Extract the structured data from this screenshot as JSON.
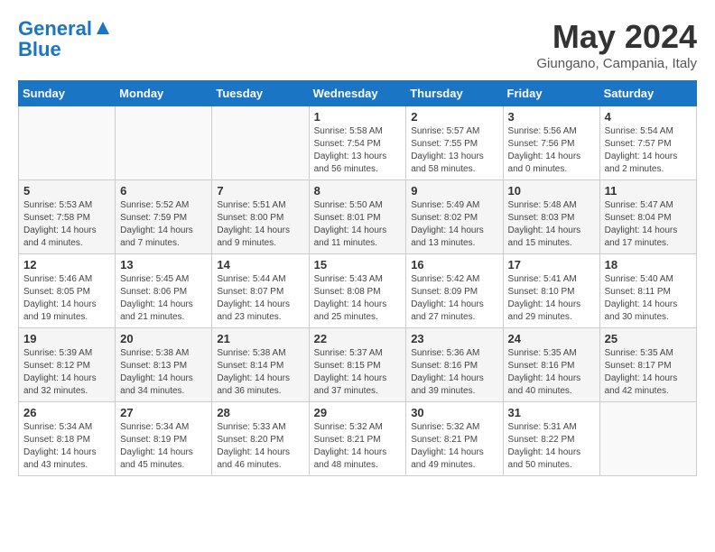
{
  "header": {
    "logo_line1": "General",
    "logo_line2": "Blue",
    "month_title": "May 2024",
    "location": "Giungano, Campania, Italy"
  },
  "days_of_week": [
    "Sunday",
    "Monday",
    "Tuesday",
    "Wednesday",
    "Thursday",
    "Friday",
    "Saturday"
  ],
  "weeks": [
    [
      {
        "day": "",
        "info": ""
      },
      {
        "day": "",
        "info": ""
      },
      {
        "day": "",
        "info": ""
      },
      {
        "day": "1",
        "info": "Sunrise: 5:58 AM\nSunset: 7:54 PM\nDaylight: 13 hours\nand 56 minutes."
      },
      {
        "day": "2",
        "info": "Sunrise: 5:57 AM\nSunset: 7:55 PM\nDaylight: 13 hours\nand 58 minutes."
      },
      {
        "day": "3",
        "info": "Sunrise: 5:56 AM\nSunset: 7:56 PM\nDaylight: 14 hours\nand 0 minutes."
      },
      {
        "day": "4",
        "info": "Sunrise: 5:54 AM\nSunset: 7:57 PM\nDaylight: 14 hours\nand 2 minutes."
      }
    ],
    [
      {
        "day": "5",
        "info": "Sunrise: 5:53 AM\nSunset: 7:58 PM\nDaylight: 14 hours\nand 4 minutes."
      },
      {
        "day": "6",
        "info": "Sunrise: 5:52 AM\nSunset: 7:59 PM\nDaylight: 14 hours\nand 7 minutes."
      },
      {
        "day": "7",
        "info": "Sunrise: 5:51 AM\nSunset: 8:00 PM\nDaylight: 14 hours\nand 9 minutes."
      },
      {
        "day": "8",
        "info": "Sunrise: 5:50 AM\nSunset: 8:01 PM\nDaylight: 14 hours\nand 11 minutes."
      },
      {
        "day": "9",
        "info": "Sunrise: 5:49 AM\nSunset: 8:02 PM\nDaylight: 14 hours\nand 13 minutes."
      },
      {
        "day": "10",
        "info": "Sunrise: 5:48 AM\nSunset: 8:03 PM\nDaylight: 14 hours\nand 15 minutes."
      },
      {
        "day": "11",
        "info": "Sunrise: 5:47 AM\nSunset: 8:04 PM\nDaylight: 14 hours\nand 17 minutes."
      }
    ],
    [
      {
        "day": "12",
        "info": "Sunrise: 5:46 AM\nSunset: 8:05 PM\nDaylight: 14 hours\nand 19 minutes."
      },
      {
        "day": "13",
        "info": "Sunrise: 5:45 AM\nSunset: 8:06 PM\nDaylight: 14 hours\nand 21 minutes."
      },
      {
        "day": "14",
        "info": "Sunrise: 5:44 AM\nSunset: 8:07 PM\nDaylight: 14 hours\nand 23 minutes."
      },
      {
        "day": "15",
        "info": "Sunrise: 5:43 AM\nSunset: 8:08 PM\nDaylight: 14 hours\nand 25 minutes."
      },
      {
        "day": "16",
        "info": "Sunrise: 5:42 AM\nSunset: 8:09 PM\nDaylight: 14 hours\nand 27 minutes."
      },
      {
        "day": "17",
        "info": "Sunrise: 5:41 AM\nSunset: 8:10 PM\nDaylight: 14 hours\nand 29 minutes."
      },
      {
        "day": "18",
        "info": "Sunrise: 5:40 AM\nSunset: 8:11 PM\nDaylight: 14 hours\nand 30 minutes."
      }
    ],
    [
      {
        "day": "19",
        "info": "Sunrise: 5:39 AM\nSunset: 8:12 PM\nDaylight: 14 hours\nand 32 minutes."
      },
      {
        "day": "20",
        "info": "Sunrise: 5:38 AM\nSunset: 8:13 PM\nDaylight: 14 hours\nand 34 minutes."
      },
      {
        "day": "21",
        "info": "Sunrise: 5:38 AM\nSunset: 8:14 PM\nDaylight: 14 hours\nand 36 minutes."
      },
      {
        "day": "22",
        "info": "Sunrise: 5:37 AM\nSunset: 8:15 PM\nDaylight: 14 hours\nand 37 minutes."
      },
      {
        "day": "23",
        "info": "Sunrise: 5:36 AM\nSunset: 8:16 PM\nDaylight: 14 hours\nand 39 minutes."
      },
      {
        "day": "24",
        "info": "Sunrise: 5:35 AM\nSunset: 8:16 PM\nDaylight: 14 hours\nand 40 minutes."
      },
      {
        "day": "25",
        "info": "Sunrise: 5:35 AM\nSunset: 8:17 PM\nDaylight: 14 hours\nand 42 minutes."
      }
    ],
    [
      {
        "day": "26",
        "info": "Sunrise: 5:34 AM\nSunset: 8:18 PM\nDaylight: 14 hours\nand 43 minutes."
      },
      {
        "day": "27",
        "info": "Sunrise: 5:34 AM\nSunset: 8:19 PM\nDaylight: 14 hours\nand 45 minutes."
      },
      {
        "day": "28",
        "info": "Sunrise: 5:33 AM\nSunset: 8:20 PM\nDaylight: 14 hours\nand 46 minutes."
      },
      {
        "day": "29",
        "info": "Sunrise: 5:32 AM\nSunset: 8:21 PM\nDaylight: 14 hours\nand 48 minutes."
      },
      {
        "day": "30",
        "info": "Sunrise: 5:32 AM\nSunset: 8:21 PM\nDaylight: 14 hours\nand 49 minutes."
      },
      {
        "day": "31",
        "info": "Sunrise: 5:31 AM\nSunset: 8:22 PM\nDaylight: 14 hours\nand 50 minutes."
      },
      {
        "day": "",
        "info": ""
      }
    ]
  ]
}
